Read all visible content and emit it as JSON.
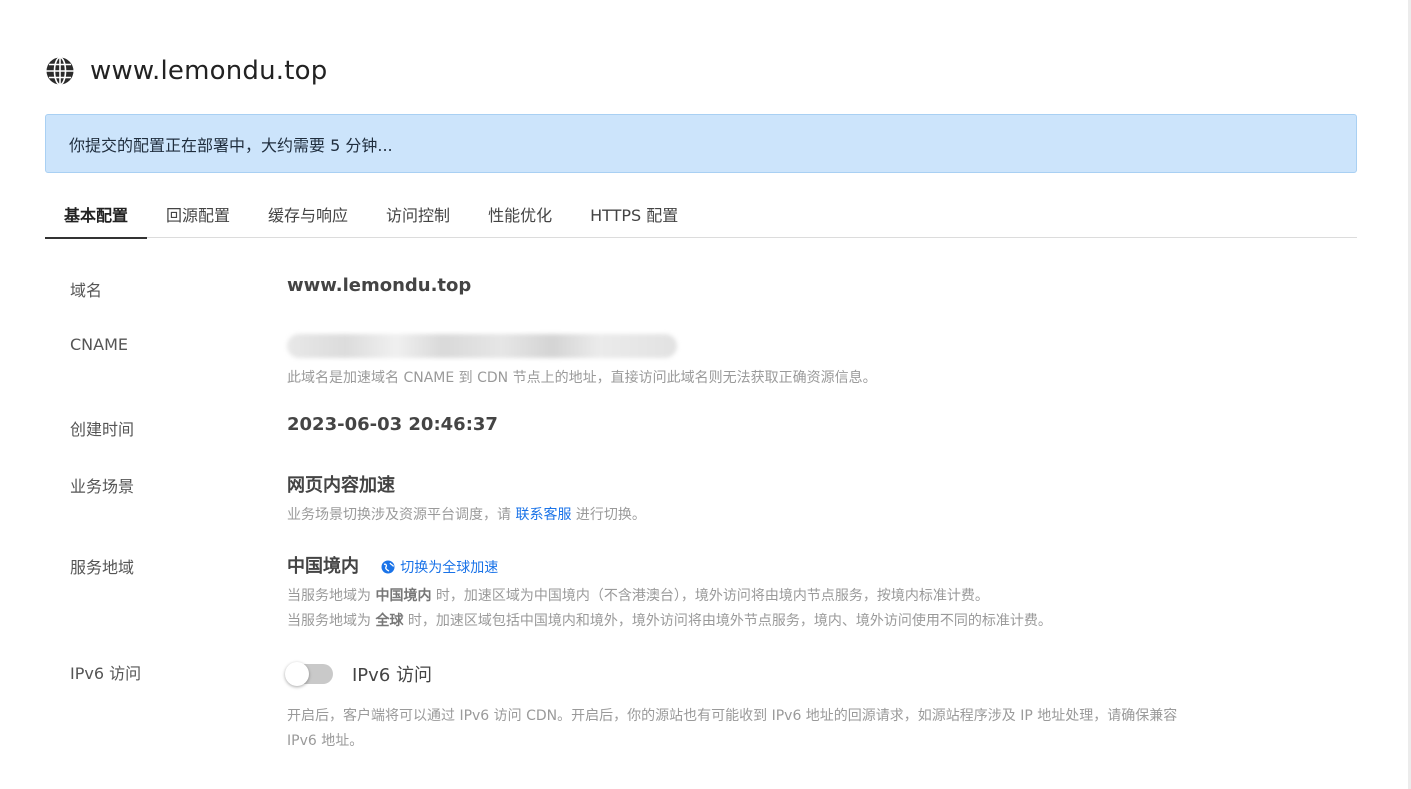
{
  "header": {
    "title": "www.lemondu.top",
    "icon": "globe-icon"
  },
  "banner": {
    "message": "你提交的配置正在部署中，大约需要 5 分钟..."
  },
  "tabs": [
    {
      "label": "基本配置",
      "active": true
    },
    {
      "label": "回源配置"
    },
    {
      "label": "缓存与响应"
    },
    {
      "label": "访问控制"
    },
    {
      "label": "性能优化"
    },
    {
      "label": "HTTPS 配置"
    }
  ],
  "fields": {
    "domain": {
      "label": "域名",
      "value": "www.lemondu.top"
    },
    "cname": {
      "label": "CNAME",
      "value": "",
      "note": "此域名是加速域名 CNAME 到 CDN 节点上的地址，直接访问此域名则无法获取正确资源信息。"
    },
    "created": {
      "label": "创建时间",
      "value": "2023-06-03 20:46:37"
    },
    "scene": {
      "label": "业务场景",
      "value": "网页内容加速",
      "note_prefix": "业务场景切换涉及资源平台调度，请 ",
      "note_link": "联系客服",
      "note_suffix": " 进行切换。"
    },
    "region": {
      "label": "服务地域",
      "value": "中国境内",
      "switch_link": "切换为全球加速",
      "note1_a": "当服务地域为 ",
      "note1_b": "中国境内",
      "note1_c": " 时，加速区域为中国境内（不含港澳台），境外访问将由境内节点服务，按境内标准计费。",
      "note2_a": "当服务地域为 ",
      "note2_b": "全球",
      "note2_c": " 时，加速区域包括中国境内和境外，境外访问将由境外节点服务，境内、境外访问使用不同的标准计费。"
    },
    "ipv6": {
      "label": "IPv6 访问",
      "toggle_label": "IPv6 访问",
      "enabled": false,
      "note_line1": "开启后，客户端将可以通过 IPv6 访问 CDN。开启后，你的源站也有可能收到 IPv6 地址的回源请求，如源站程序涉及 IP 地址处理，请确保兼容",
      "note_line2": "IPv6 地址。"
    }
  },
  "colors": {
    "banner_bg": "#cce4fb",
    "link": "#1a73e8",
    "toggle_off": "#c9c9c9"
  }
}
